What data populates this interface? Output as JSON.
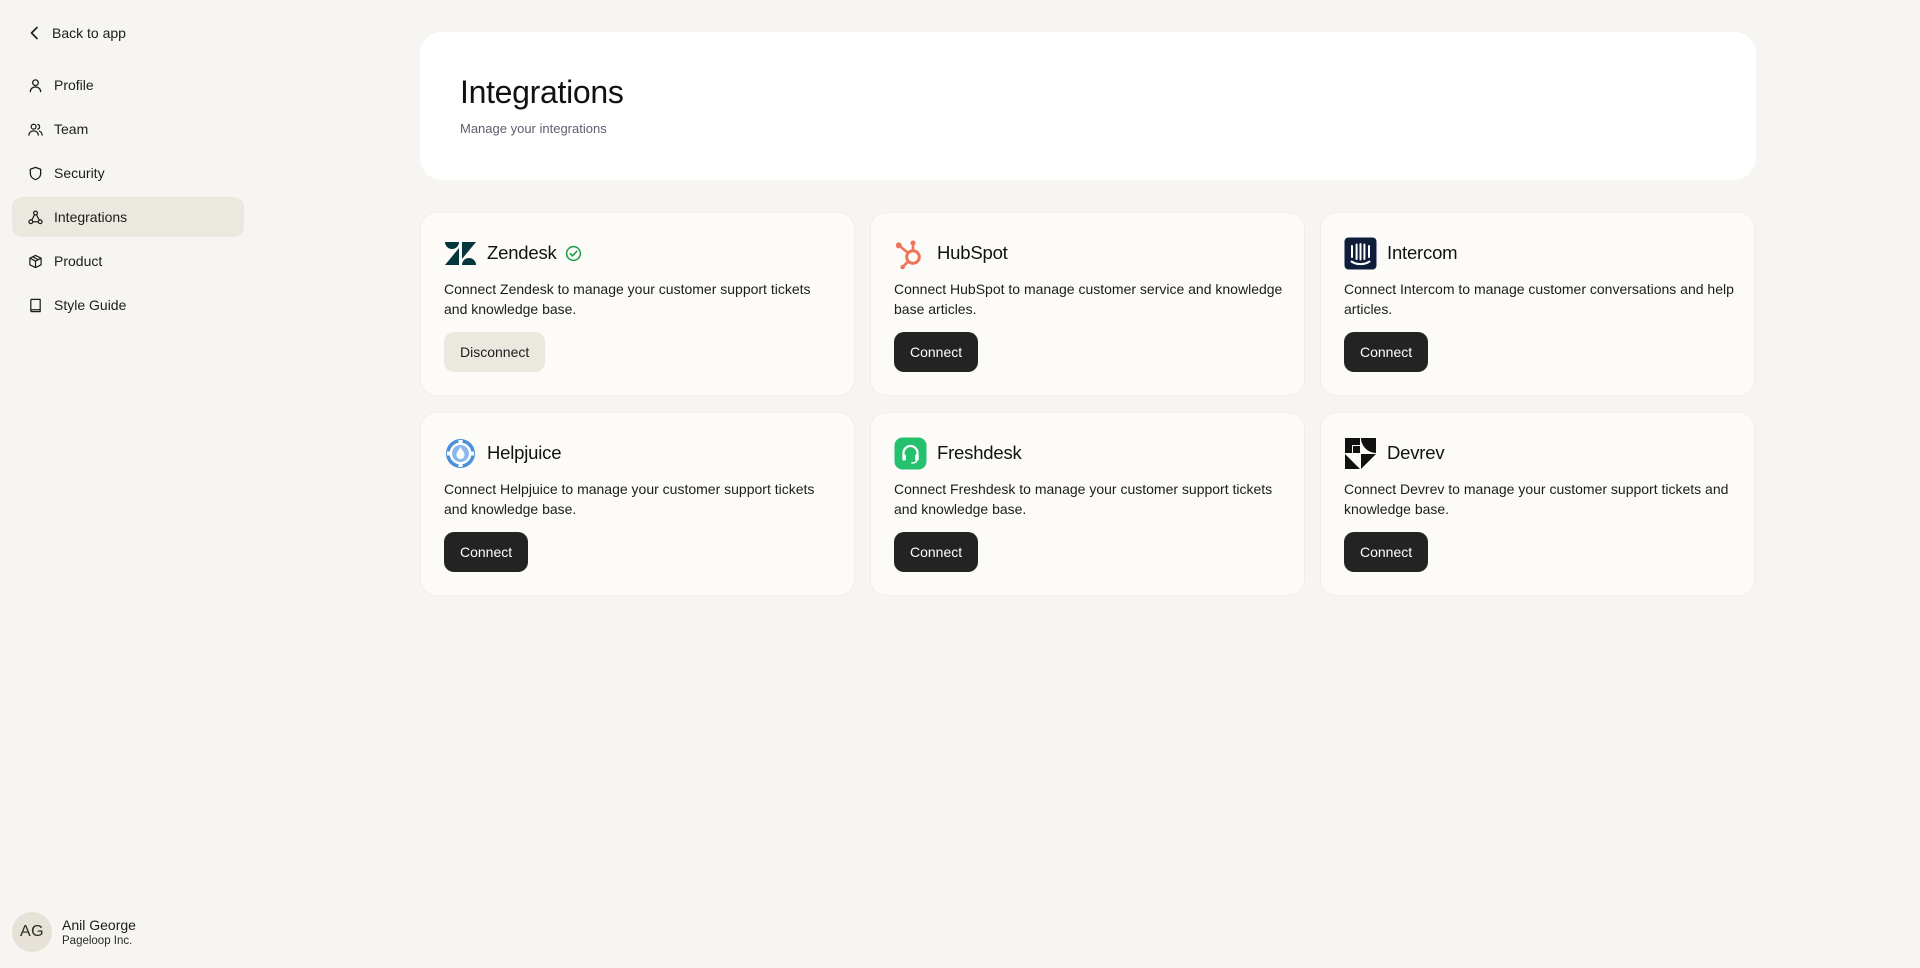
{
  "sidebar": {
    "back_label": "Back to app",
    "items": [
      {
        "label": "Profile",
        "icon": "user-icon"
      },
      {
        "label": "Team",
        "icon": "users-icon"
      },
      {
        "label": "Security",
        "icon": "shield-icon"
      },
      {
        "label": "Integrations",
        "icon": "integrations-icon",
        "active": true
      },
      {
        "label": "Product",
        "icon": "box-icon"
      },
      {
        "label": "Style Guide",
        "icon": "book-icon"
      }
    ],
    "user": {
      "initials": "AG",
      "name": "Anil George",
      "org": "Pageloop Inc."
    }
  },
  "header": {
    "title": "Integrations",
    "subtitle": "Manage your integrations"
  },
  "integrations": [
    {
      "name": "Zendesk",
      "connected": true,
      "description": "Connect Zendesk to manage your customer support tickets and knowledge base.",
      "button": "Disconnect",
      "icon": "zendesk-logo"
    },
    {
      "name": "HubSpot",
      "connected": false,
      "description": "Connect HubSpot to manage customer service and knowledge base articles.",
      "button": "Connect",
      "icon": "hubspot-logo"
    },
    {
      "name": "Intercom",
      "connected": false,
      "description": "Connect Intercom to manage customer conversations and help articles.",
      "button": "Connect",
      "icon": "intercom-logo"
    },
    {
      "name": "Helpjuice",
      "connected": false,
      "description": "Connect Helpjuice to manage your customer support tickets and knowledge base.",
      "button": "Connect",
      "icon": "helpjuice-logo"
    },
    {
      "name": "Freshdesk",
      "connected": false,
      "description": "Connect Freshdesk to manage your customer support tickets and knowledge base.",
      "button": "Connect",
      "icon": "freshdesk-logo"
    },
    {
      "name": "Devrev",
      "connected": false,
      "description": "Connect Devrev to manage your customer support tickets and knowledge base.",
      "button": "Connect",
      "icon": "devrev-logo"
    }
  ],
  "colors": {
    "background": "#f6f5f1",
    "primary_button": "#232323",
    "secondary_button": "#ebe8e0",
    "connected_check": "#1e9e4a",
    "hubspot": "#f0745a",
    "intercom": "#0f1d3a",
    "freshdesk": "#25c16f",
    "helpjuice": "#4a8fd8"
  }
}
